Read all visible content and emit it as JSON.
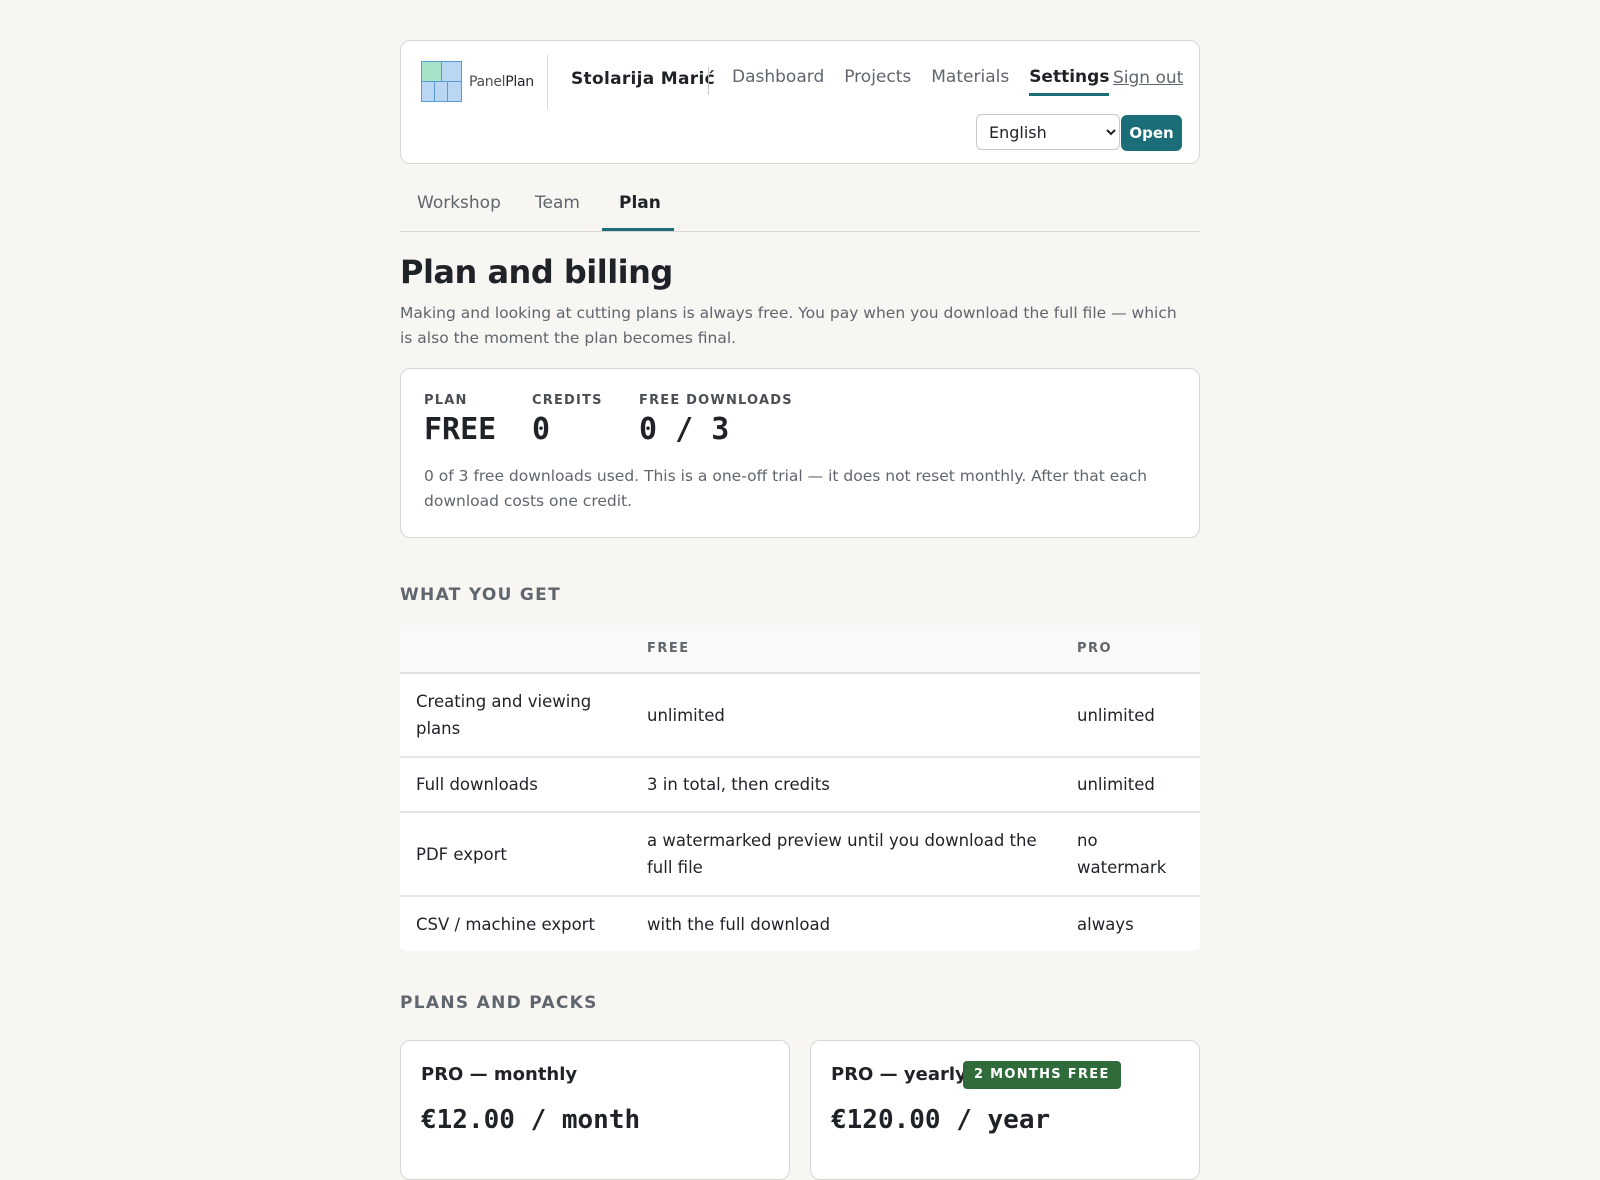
{
  "brand": {
    "logo_prefix": "Panel",
    "logo_suffix": "Plan"
  },
  "header": {
    "user_name": "Stolarija Marić",
    "nav": [
      "Dashboard",
      "Projects",
      "Materials",
      "Settings"
    ],
    "active_nav": "Settings",
    "sign_out": "Sign out",
    "language_selected": "English",
    "open_button": "Open"
  },
  "tabs": {
    "items": [
      "Workshop",
      "Team",
      "Plan"
    ],
    "active": "Plan"
  },
  "page": {
    "title": "Plan and billing",
    "intro": "Making and looking at cutting plans is always free. You pay when you download the full file — which is also the moment the plan becomes final."
  },
  "stats": {
    "plan_label": "PLAN",
    "plan_value": "FREE",
    "credits_label": "CREDITS",
    "credits_value": "0",
    "downloads_label": "FREE DOWNLOADS",
    "downloads_value": "0 / 3",
    "note": "0 of 3 free downloads used. This is a one-off trial — it does not reset monthly. After that each download costs one credit."
  },
  "features": {
    "section_title": "WHAT YOU GET",
    "columns": [
      "",
      "FREE",
      "PRO"
    ],
    "rows": [
      [
        "Creating and viewing plans",
        "unlimited",
        "unlimited"
      ],
      [
        "Full downloads",
        "3 in total, then credits",
        "unlimited"
      ],
      [
        "PDF export",
        "a watermarked preview until you download the full file",
        "no watermark"
      ],
      [
        "CSV / machine export",
        "with the full download",
        "always"
      ]
    ]
  },
  "plans": {
    "section_title": "PLANS AND PACKS",
    "monthly": {
      "name": "PRO — monthly",
      "price": "€12.00 / month"
    },
    "yearly": {
      "name": "PRO — yearly",
      "badge": "2 MONTHS FREE",
      "price": "€120.00 / year"
    }
  },
  "colors": {
    "accent": "#1b6e78",
    "badge": "#2f6b3b",
    "background": "#f7f6f3"
  }
}
